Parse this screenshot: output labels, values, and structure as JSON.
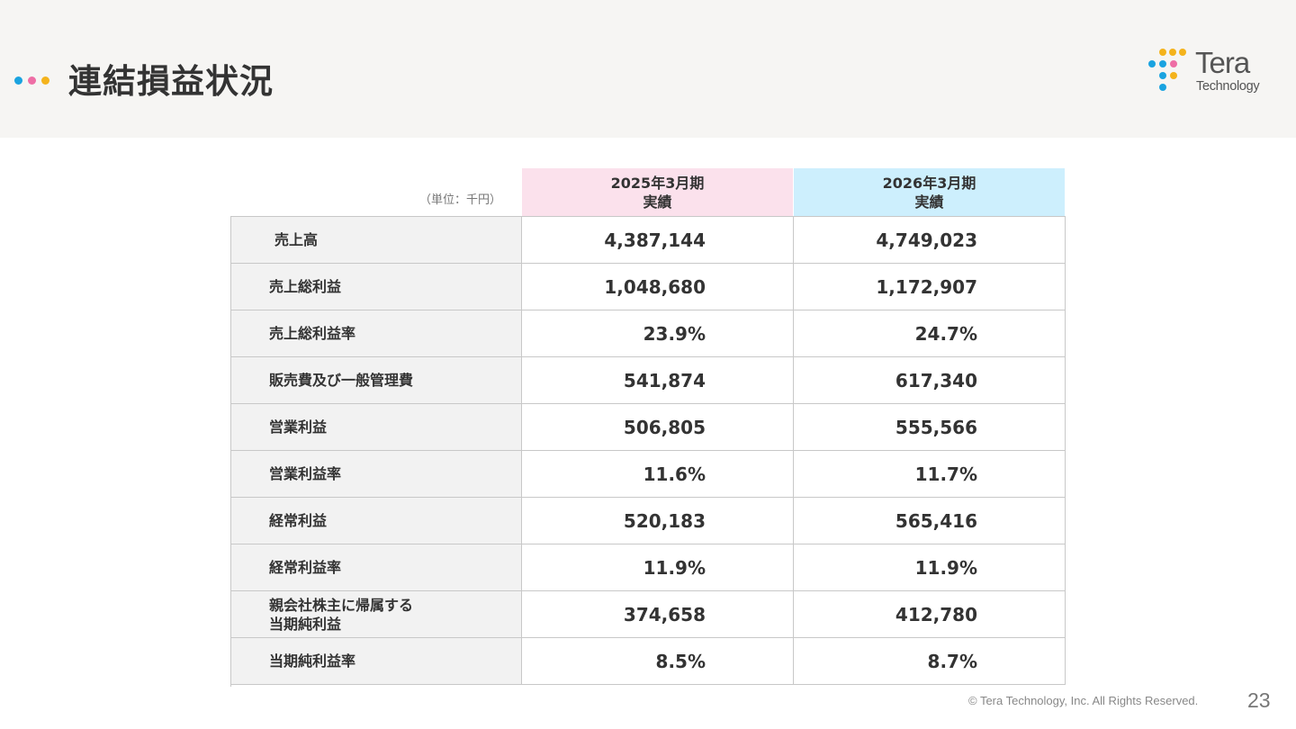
{
  "header": {
    "title": "連結損益状況",
    "dot_colors": [
      "#1aa3e0",
      "#ee6ea5",
      "#f4b31c"
    ]
  },
  "logo": {
    "word1": "Tera",
    "word2": "Technology",
    "icon": "tera-dot-logo-icon",
    "dot_colors": [
      "#f4b31c",
      "#1aa3e0",
      "#ee6ea5"
    ]
  },
  "table": {
    "unit": "（単位：千円）",
    "columns": [
      {
        "period": "2025年3月期",
        "kind": "実績",
        "color": "#fbe1ec"
      },
      {
        "period": "2026年3月期",
        "kind": "実績",
        "color": "#cdeffd"
      }
    ],
    "rows": [
      {
        "label": "売上高",
        "v1": "4,387,144",
        "v2": "4,749,023"
      },
      {
        "label": "売上総利益",
        "v1": "1,048,680",
        "v2": "1,172,907"
      },
      {
        "label": "売上総利益率",
        "v1": "23.9%",
        "v2": "24.7%"
      },
      {
        "label": "販売費及び一般管理費",
        "v1": "541,874",
        "v2": "617,340"
      },
      {
        "label": "営業利益",
        "v1": "506,805",
        "v2": "555,566"
      },
      {
        "label": "営業利益率",
        "v1": "11.6%",
        "v2": "11.7%"
      },
      {
        "label": "経常利益",
        "v1": "520,183",
        "v2": "565,416"
      },
      {
        "label": "経常利益率",
        "v1": "11.9%",
        "v2": "11.9%"
      },
      {
        "label": "親会社株主に帰属する\n当期純利益",
        "v1": "374,658",
        "v2": "412,780"
      },
      {
        "label": "当期純利益率",
        "v1": "8.5%",
        "v2": "8.7%"
      }
    ]
  },
  "footer": {
    "copyright": "© Tera Technology, Inc. All Rights Reserved.",
    "page_number": "23"
  }
}
